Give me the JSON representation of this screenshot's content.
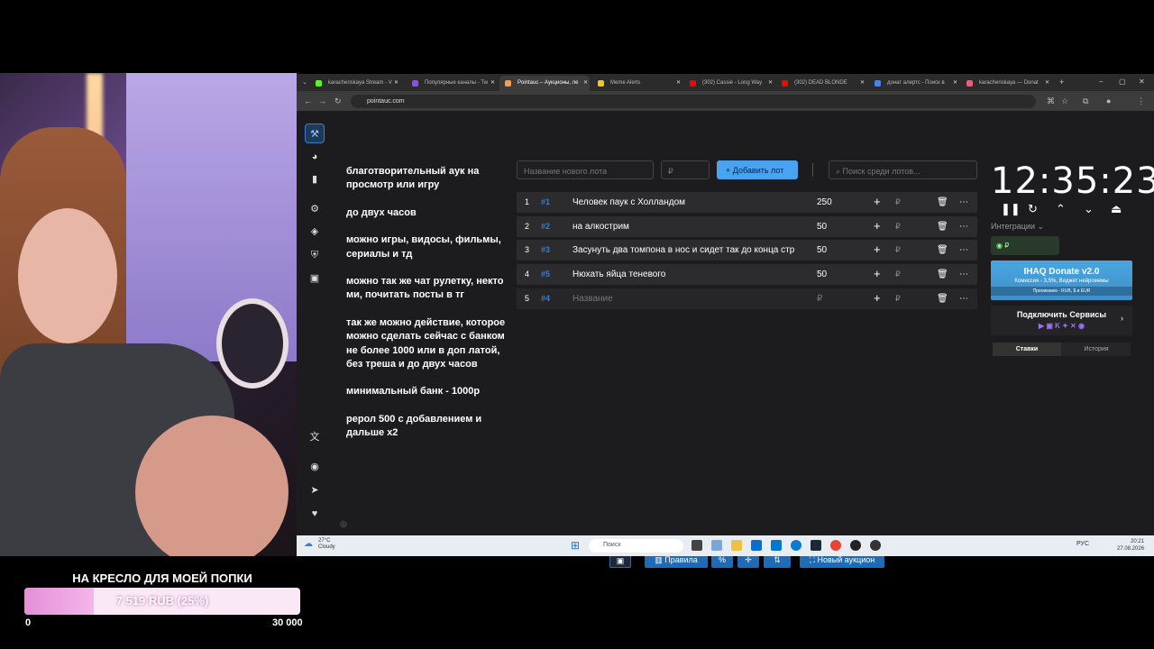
{
  "overlay": {
    "goal_title": "НА КРЕСЛО ДЛЯ МОЕЙ ПОПКИ",
    "goal_amount": "7 519 RUB (25%)",
    "goal_progress": 0.25,
    "goal_min": "0",
    "goal_max": "30 000"
  },
  "browser": {
    "tabs": [
      {
        "label": "karachenskaya Stream - V",
        "color": "#53fc18"
      },
      {
        "label": "Популярные каналы - Tw",
        "color": "#9146ff"
      },
      {
        "label": "Pointauc – Аукционы, ле",
        "color": "#f0a050",
        "active": true
      },
      {
        "label": "Meme Alerts",
        "color": "#f5c518"
      },
      {
        "label": "(302) Cassie - Long Way",
        "color": "#ff0000"
      },
      {
        "label": "(302) DEAD BLONDE",
        "color": "#ff0000"
      },
      {
        "label": "донат алертс - Поиск в",
        "color": "#4285f4"
      },
      {
        "label": "karachenskaya — Donat",
        "color": "#f05a78"
      }
    ],
    "url": "pointauc.com"
  },
  "rules": [
    "благотворительный аук на просмотр или игру",
    "до  двух часов",
    "можно игры, видосы, фильмы, сериалы и тд",
    "можно так же чат рулетку, некто ми, почитать посты в тг",
    "так же можно действие, которое можно сделать сейчас с банком не более 1000 или в доп латой, без треша  и до двух часов",
    "минимальный банк - 1000р",
    "рерол 500 с добавлением и дальше х2"
  ],
  "toolbar": {
    "lot_placeholder": "Название нового лота",
    "amount_placeholder": "₽",
    "add_button": "Добавить лот",
    "search_placeholder": "Поиск среди лотов..."
  },
  "lots": [
    {
      "index": "1",
      "id": "#1",
      "name": "Человек паук с Холландом",
      "amount": "250"
    },
    {
      "index": "2",
      "id": "#2",
      "name": "на алкострим",
      "amount": "50"
    },
    {
      "index": "3",
      "id": "#3",
      "name": "Засунуть два томпона в нос и сидет так до конца стр",
      "amount": "50"
    },
    {
      "index": "4",
      "id": "#5",
      "name": "Нюхать яйца теневого",
      "amount": "50"
    },
    {
      "index": "5",
      "id": "#4",
      "name": "Название",
      "amount": "₽"
    }
  ],
  "timer": "12:35:23",
  "integrations": {
    "label": "Интеграции",
    "ihaq_title": "IHAQ Donate v2.0",
    "ihaq_sub": "Комиссия - 3,5%, Виджет нейромемы",
    "ihaq_accept": "Принимаем - RUB, $ и EUR",
    "connect": "Подключить Сервисы",
    "tab_bets": "Ставки",
    "tab_history": "История"
  },
  "bottom": {
    "rules": "Правила",
    "percent": "%",
    "new_auction": "Новый аукцион"
  },
  "taskbar": {
    "weather_temp": "27°C",
    "weather_desc": "Cloudy",
    "search": "Поиск",
    "lang": "РУС",
    "time": "20:21",
    "date": "27.08.2026"
  }
}
